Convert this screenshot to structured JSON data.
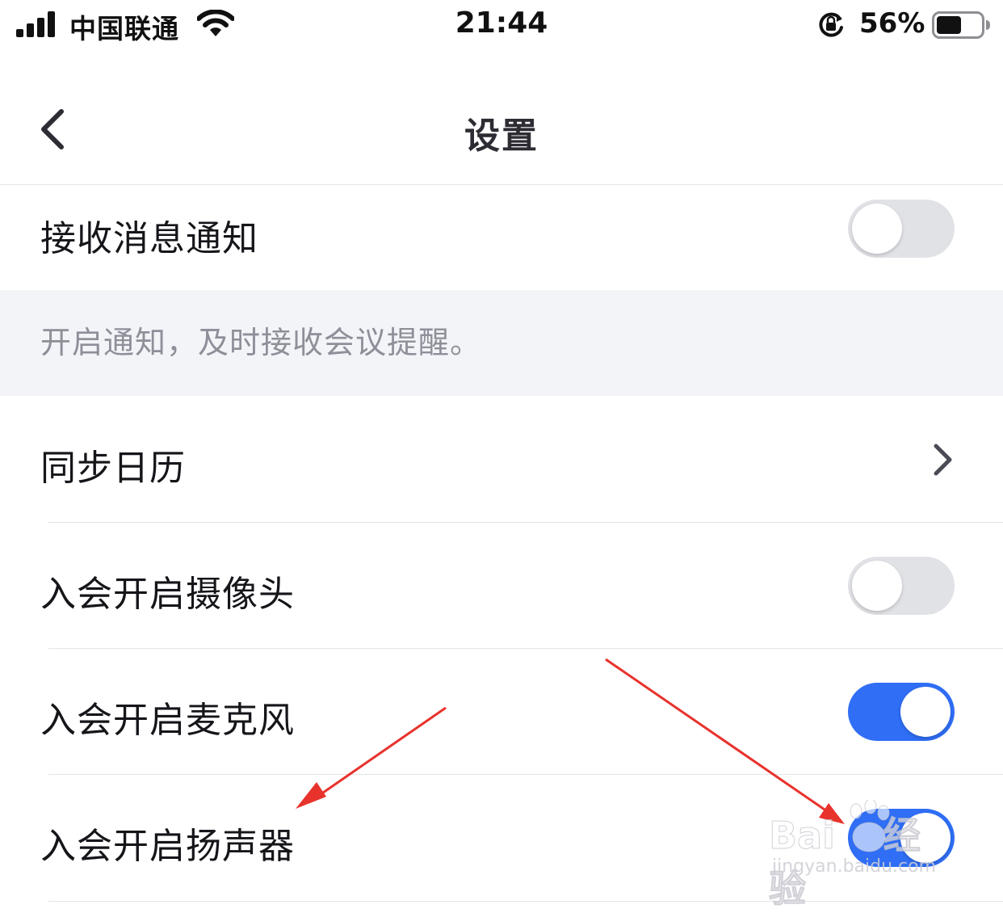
{
  "status_bar": {
    "carrier": "中国联通",
    "time": "21:44",
    "battery_percent": "56%",
    "battery_level": 0.56,
    "icons": [
      "signal-icon",
      "wifi-icon",
      "orientation-lock-icon",
      "battery-icon"
    ]
  },
  "nav": {
    "title": "设置",
    "back_icon": "chevron-left-icon"
  },
  "settings": {
    "notify": {
      "label": "接收消息通知",
      "enabled": false
    },
    "notify_hint": "开启通知，及时接收会议提醒。",
    "sync_calendar": {
      "label": "同步日历",
      "icon": "chevron-right-icon"
    },
    "camera": {
      "label": "入会开启摄像头",
      "enabled": false
    },
    "microphone": {
      "label": "入会开启麦克风",
      "enabled": true
    },
    "speaker": {
      "label": "入会开启扬声器",
      "enabled": true
    }
  },
  "watermark": {
    "brand": "Bai",
    "brand_cn": "经验",
    "url": "jingyan.baidu.com"
  },
  "colors": {
    "toggle_on": "#2f6ef5",
    "toggle_off": "#e1e2e6",
    "hint_background": "#f3f4f8",
    "annotation_arrow": "#e8322c"
  }
}
